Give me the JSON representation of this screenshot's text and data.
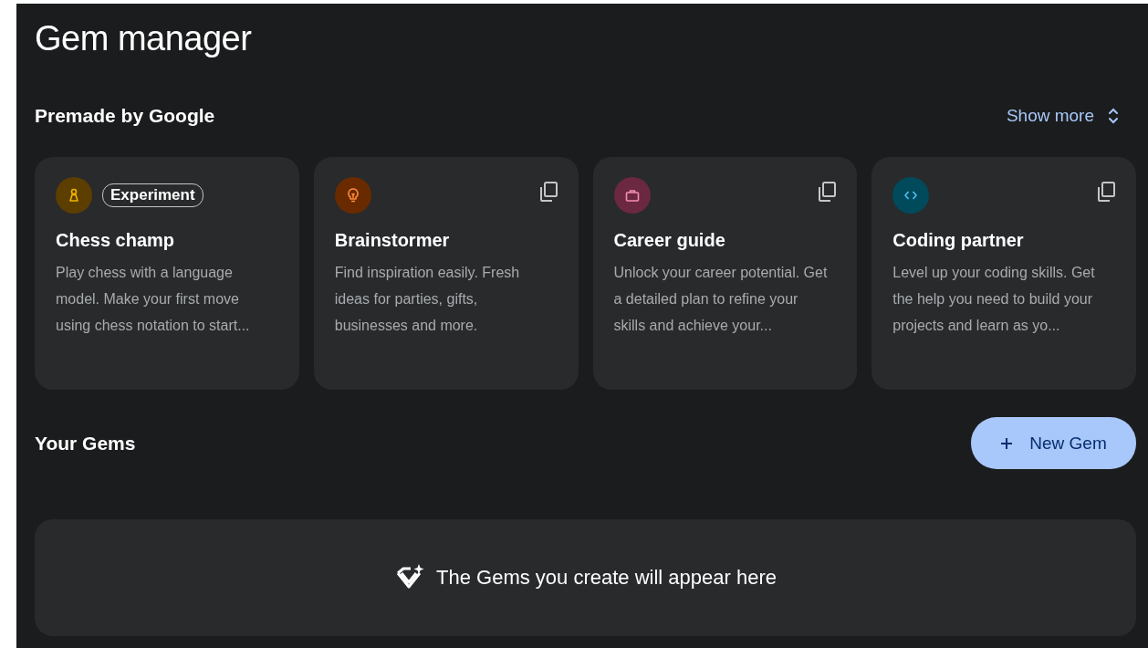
{
  "title": "Gem manager",
  "premade": {
    "heading": "Premade by Google",
    "show_more": "Show more",
    "cards": [
      {
        "kind": "pawn",
        "color": "#5c3e00",
        "badge": "Experiment",
        "copyable": false,
        "name": "Chess champ",
        "description": "Play chess with a language model. Make your first move using chess notation to start..."
      },
      {
        "kind": "bulb",
        "color": "#6a2a00",
        "copyable": true,
        "name": "Brainstormer",
        "description": "Find inspiration easily. Fresh ideas for parties, gifts, businesses and more."
      },
      {
        "kind": "briefcase",
        "color": "#6b2840",
        "copyable": true,
        "name": "Career guide",
        "description": "Unlock your career potential. Get a detailed plan to refine your skills and achieve your..."
      },
      {
        "kind": "code",
        "color": "#004a5c",
        "copyable": true,
        "name": "Coding partner",
        "description": "Level up your coding skills. Get the help you need to build your projects and learn as yo..."
      }
    ]
  },
  "your_gems": {
    "heading": "Your Gems",
    "new_button": "New Gem",
    "empty_message": "The Gems you create will appear here"
  }
}
